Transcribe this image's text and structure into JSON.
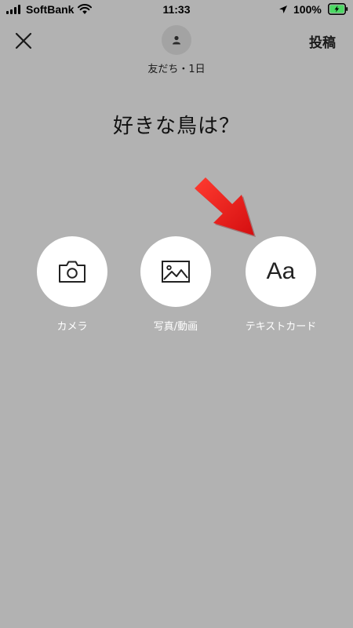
{
  "status_bar": {
    "carrier": "SoftBank",
    "time": "11:33",
    "battery_percent": "100%",
    "icons": [
      "signal-icon",
      "wifi-icon",
      "location-icon",
      "battery-charging-icon"
    ]
  },
  "header": {
    "close_icon": "close-icon",
    "avatar_icon": "person-icon",
    "audience": "友だち・1日",
    "post_label": "投稿"
  },
  "prompt": "好きな鳥は？",
  "options": [
    {
      "id": "camera",
      "icon": "camera-icon",
      "label": "カメラ"
    },
    {
      "id": "photo-video",
      "icon": "image-icon",
      "label": "写真/動画"
    },
    {
      "id": "text-card",
      "icon": "text-card-icon",
      "glyph": "Aa",
      "label": "テキストカード"
    }
  ],
  "annotation": {
    "icon": "red-arrow-icon",
    "color": "#e8191b"
  },
  "colors": {
    "background": "#b2b2b2",
    "option_circle": "#ffffff",
    "option_label": "#ffffff",
    "accent_arrow": "#e8191b",
    "battery_fill": "#4cd964"
  }
}
